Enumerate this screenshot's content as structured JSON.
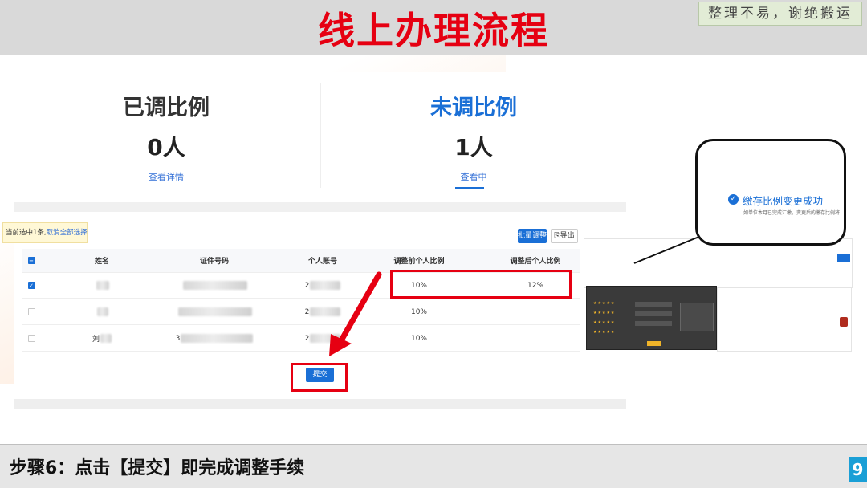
{
  "slide": {
    "title": "线上办理流程",
    "watermark_note": "整理不易，谢绝搬运",
    "step_text": "步骤6：点击【提交】即完成调整手续",
    "page_number": "9"
  },
  "stats": {
    "adjusted": {
      "title": "已调比例",
      "count": "0人",
      "link": "查看详情"
    },
    "not_adjusted": {
      "title": "未调比例",
      "count": "1人",
      "link": "查看中"
    }
  },
  "selection_tip": {
    "text": "当前选中1条,",
    "link": "取消全部选择"
  },
  "toolbar": {
    "batch_label": "批量调整",
    "export_label": "导出"
  },
  "table": {
    "headers": [
      "姓名",
      "证件号码",
      "个人账号",
      "调整前个人比例",
      "调整后个人比例"
    ],
    "rows": [
      {
        "checked": true,
        "name_prefix": "",
        "id_prefix": "",
        "acct_prefix": "2",
        "before": "10%",
        "after": "12%"
      },
      {
        "checked": false,
        "name_prefix": "",
        "id_prefix": "",
        "acct_prefix": "2",
        "before": "10%",
        "after": ""
      },
      {
        "checked": false,
        "name_prefix": "刘",
        "id_prefix": "3",
        "acct_prefix": "2",
        "before": "10%",
        "after": ""
      }
    ]
  },
  "submit_label": "提交",
  "callout": {
    "title": "缴存比例变更成功",
    "subtitle": "如单位本月已完成汇缴，变更后的缴存比例将"
  },
  "colors": {
    "accent": "#1a6fd6",
    "highlight_red": "#e60012",
    "title_red": "#e60012"
  }
}
